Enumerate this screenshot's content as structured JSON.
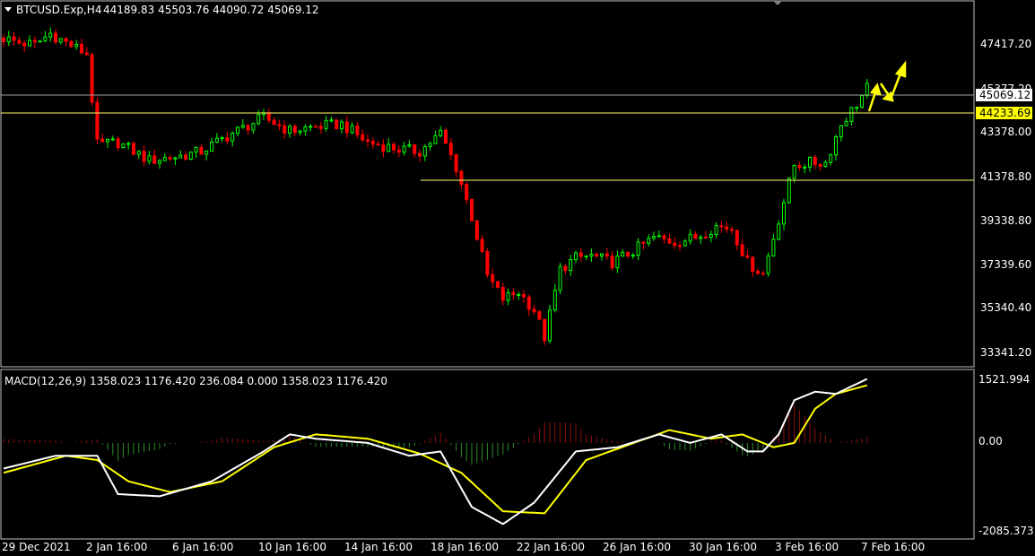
{
  "header": {
    "symbol_label": "BTCUSD.Exp,H4",
    "ohlc": "44189.83 45503.76 44090.72 45069.12"
  },
  "colors": {
    "background": "#000000",
    "bull": "#00ff00",
    "bear": "#ff0000",
    "frame": "#c0c0c0",
    "support_line": "#ffff66",
    "current_line": "#a0a0a0",
    "arrow": "#ffff00",
    "macd_line": "#ffffff",
    "signal_line": "#ffff00",
    "hist_up": "#8b1010",
    "hist_down": "#2e8b2e"
  },
  "price_axis": {
    "labels": [
      "47417.20",
      "45377.20",
      "43378.00",
      "41378.80",
      "39338.80",
      "37339.60",
      "35340.40",
      "33341.20"
    ],
    "current_price": "45069.12",
    "level_price": "44233.69"
  },
  "macd": {
    "label": "MACD(12,26,9) 1358.023 1176.420 236.084 0.000 1358.023 1176.420",
    "axis_labels": [
      "1521.994",
      "0.00",
      "-2085.373"
    ]
  },
  "time_axis": {
    "labels": [
      "29 Dec 2021",
      "2 Jan 16:00",
      "6 Jan 16:00",
      "10 Jan 16:00",
      "14 Jan 16:00",
      "18 Jan 16:00",
      "22 Jan 16:00",
      "26 Jan 16:00",
      "30 Jan 16:00",
      "3 Feb 16:00",
      "7 Feb 16:00"
    ]
  },
  "chart_data": {
    "type": "candlestick",
    "price_range": [
      32700,
      48800
    ],
    "macd_range": [
      -2250,
      1700
    ],
    "price_path": [
      [
        0,
        47200
      ],
      [
        3,
        47000
      ],
      [
        6,
        46900
      ],
      [
        9,
        47400
      ],
      [
        12,
        47000
      ],
      [
        16,
        46500
      ],
      [
        18,
        42500
      ],
      [
        22,
        42600
      ],
      [
        28,
        41800
      ],
      [
        34,
        42000
      ],
      [
        38,
        42200
      ],
      [
        44,
        43000
      ],
      [
        50,
        43700
      ],
      [
        55,
        43100
      ],
      [
        60,
        43300
      ],
      [
        65,
        43400
      ],
      [
        70,
        42600
      ],
      [
        76,
        42300
      ],
      [
        80,
        42200
      ],
      [
        84,
        43000
      ],
      [
        87,
        41500
      ],
      [
        90,
        39300
      ],
      [
        93,
        36700
      ],
      [
        96,
        35700
      ],
      [
        99,
        36000
      ],
      [
        102,
        35200
      ],
      [
        104,
        34000
      ],
      [
        107,
        37000
      ],
      [
        110,
        37500
      ],
      [
        113,
        37600
      ],
      [
        117,
        37300
      ],
      [
        121,
        37800
      ],
      [
        125,
        38400
      ],
      [
        129,
        38200
      ],
      [
        133,
        38400
      ],
      [
        137,
        38900
      ],
      [
        140,
        38800
      ],
      [
        143,
        37300
      ],
      [
        146,
        36800
      ],
      [
        149,
        39200
      ],
      [
        152,
        41600
      ],
      [
        155,
        41700
      ],
      [
        158,
        41700
      ],
      [
        161,
        43400
      ],
      [
        164,
        44300
      ],
      [
        166,
        45000
      ]
    ],
    "macd_path": [
      [
        0,
        -600
      ],
      [
        10,
        -300
      ],
      [
        18,
        -300
      ],
      [
        22,
        -1200
      ],
      [
        30,
        -1250
      ],
      [
        40,
        -900
      ],
      [
        50,
        -200
      ],
      [
        55,
        200
      ],
      [
        60,
        100
      ],
      [
        70,
        0
      ],
      [
        78,
        -300
      ],
      [
        84,
        -200
      ],
      [
        90,
        -1500
      ],
      [
        96,
        -1900
      ],
      [
        102,
        -1400
      ],
      [
        110,
        -200
      ],
      [
        118,
        -100
      ],
      [
        126,
        200
      ],
      [
        132,
        0
      ],
      [
        138,
        200
      ],
      [
        143,
        -200
      ],
      [
        146,
        -200
      ],
      [
        149,
        200
      ],
      [
        152,
        1000
      ],
      [
        156,
        1200
      ],
      [
        160,
        1150
      ],
      [
        166,
        1500
      ]
    ],
    "signal_path": [
      [
        0,
        -700
      ],
      [
        12,
        -300
      ],
      [
        18,
        -400
      ],
      [
        24,
        -900
      ],
      [
        32,
        -1150
      ],
      [
        42,
        -900
      ],
      [
        52,
        -100
      ],
      [
        60,
        200
      ],
      [
        70,
        100
      ],
      [
        80,
        -250
      ],
      [
        88,
        -700
      ],
      [
        96,
        -1600
      ],
      [
        104,
        -1650
      ],
      [
        112,
        -400
      ],
      [
        120,
        -50
      ],
      [
        128,
        300
      ],
      [
        136,
        100
      ],
      [
        142,
        200
      ],
      [
        148,
        -100
      ],
      [
        152,
        0
      ],
      [
        156,
        800
      ],
      [
        160,
        1150
      ],
      [
        166,
        1350
      ]
    ]
  }
}
